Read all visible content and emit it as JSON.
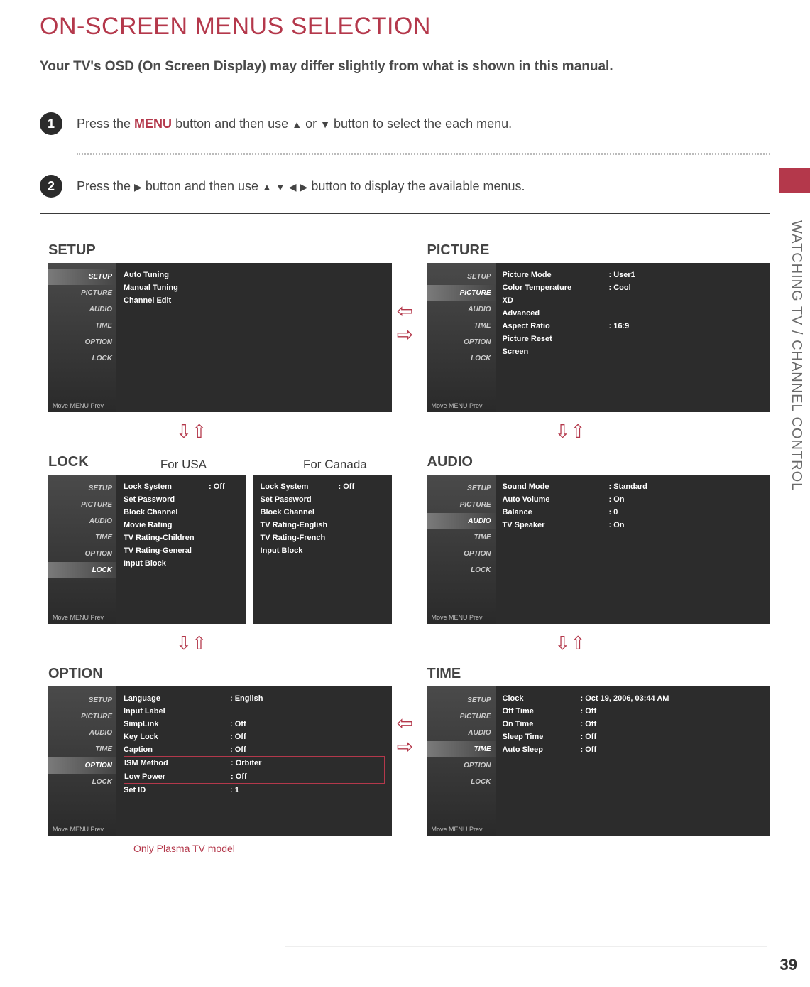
{
  "title": "ON-SCREEN MENUS SELECTION",
  "subtitle": "Your TV's OSD (On Screen Display) may differ slightly from what is shown in this manual.",
  "steps": {
    "one": {
      "num": "1",
      "p1": "Press the ",
      "menu": "MENU",
      "p2": " button and then use ",
      "p3": " or ",
      "p4": " button to select the each menu."
    },
    "two": {
      "num": "2",
      "p1": "Press the ",
      "p2": " button and then use ",
      "p3": " button to display the available menus."
    }
  },
  "side_tabs": [
    "SETUP",
    "PICTURE",
    "AUDIO",
    "TIME",
    "OPTION",
    "LOCK"
  ],
  "footer_hint": "Move  MENU  Prev",
  "section_side_text": "WATCHING TV / CHANNEL CONTROL",
  "page_number": "39",
  "plasma_note": "Only Plasma TV model",
  "labels": {
    "for_usa": "For USA",
    "for_canada": "For Canada"
  },
  "setup": {
    "title": "SETUP",
    "items": [
      {
        "k": "Auto Tuning",
        "v": ""
      },
      {
        "k": "Manual Tuning",
        "v": ""
      },
      {
        "k": "Channel Edit",
        "v": ""
      }
    ]
  },
  "picture": {
    "title": "PICTURE",
    "items": [
      {
        "k": "Picture Mode",
        "v": ": User1"
      },
      {
        "k": "Color Temperature",
        "v": ": Cool"
      },
      {
        "k": "XD",
        "v": ""
      },
      {
        "k": "Advanced",
        "v": ""
      },
      {
        "k": "Aspect Ratio",
        "v": ": 16:9"
      },
      {
        "k": "Picture Reset",
        "v": ""
      },
      {
        "k": "Screen",
        "v": ""
      }
    ]
  },
  "lock": {
    "title": "LOCK",
    "usa_items": [
      {
        "k": "Lock System",
        "v": ": Off"
      },
      {
        "k": "Set Password",
        "v": ""
      },
      {
        "k": "Block Channel",
        "v": ""
      },
      {
        "k": "Movie Rating",
        "v": ""
      },
      {
        "k": "TV Rating-Children",
        "v": ""
      },
      {
        "k": "TV Rating-General",
        "v": ""
      },
      {
        "k": "Input Block",
        "v": ""
      }
    ],
    "canada_items": [
      {
        "k": "Lock System",
        "v": ": Off"
      },
      {
        "k": "Set Password",
        "v": ""
      },
      {
        "k": "Block Channel",
        "v": ""
      },
      {
        "k": "TV Rating-English",
        "v": ""
      },
      {
        "k": "TV Rating-French",
        "v": ""
      },
      {
        "k": "Input Block",
        "v": ""
      }
    ]
  },
  "audio": {
    "title": "AUDIO",
    "items": [
      {
        "k": "Sound Mode",
        "v": ": Standard"
      },
      {
        "k": "Auto Volume",
        "v": ": On"
      },
      {
        "k": "Balance",
        "v": ": 0"
      },
      {
        "k": "TV Speaker",
        "v": ": On"
      }
    ]
  },
  "option": {
    "title": "OPTION",
    "items": [
      {
        "k": "Language",
        "v": ": English"
      },
      {
        "k": "Input Label",
        "v": ""
      },
      {
        "k": "SimpLink",
        "v": ": Off"
      },
      {
        "k": "Key Lock",
        "v": ": Off"
      },
      {
        "k": "Caption",
        "v": ": Off"
      },
      {
        "k": "ISM Method",
        "v": ": Orbiter"
      },
      {
        "k": "Low Power",
        "v": ": Off"
      },
      {
        "k": "Set ID",
        "v": ": 1"
      }
    ]
  },
  "time": {
    "title": "TIME",
    "items": [
      {
        "k": "Clock",
        "v": ": Oct 19, 2006, 03:44 AM"
      },
      {
        "k": "Off Time",
        "v": ": Off"
      },
      {
        "k": "On Time",
        "v": ": Off"
      },
      {
        "k": "Sleep Time",
        "v": ": Off"
      },
      {
        "k": "Auto Sleep",
        "v": ": Off"
      }
    ]
  }
}
